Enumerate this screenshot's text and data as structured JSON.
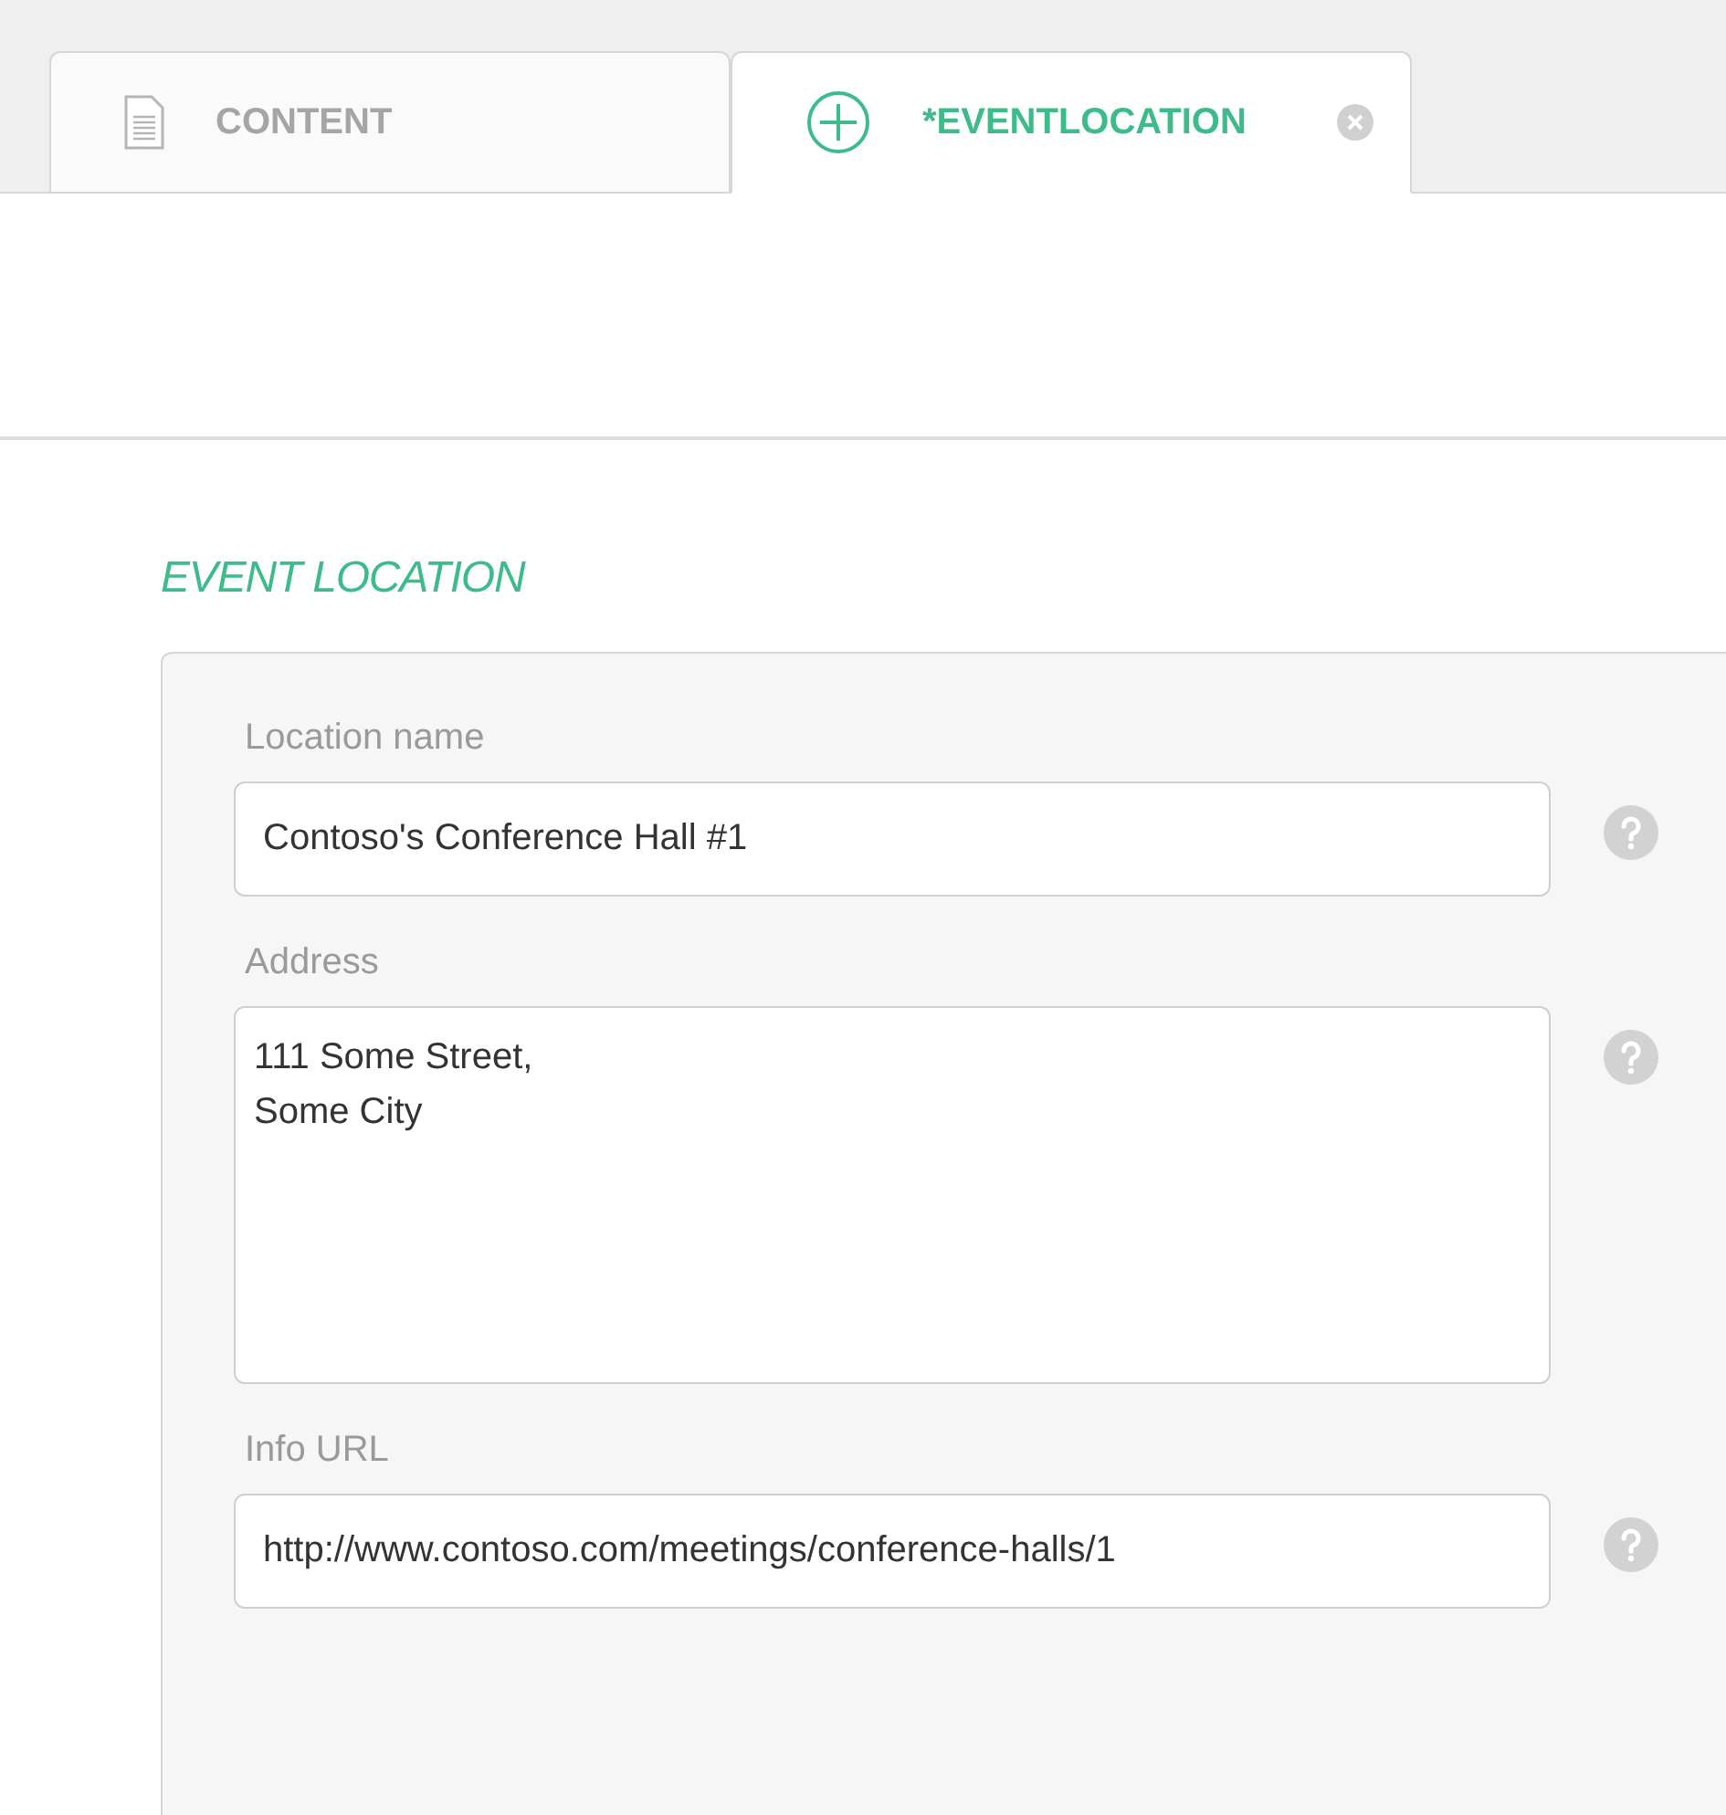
{
  "tabs": [
    {
      "label": "CONTENT",
      "kind": "document",
      "selected": false,
      "closable": false
    },
    {
      "label": "*EVENTLOCATION",
      "kind": "add",
      "selected": true,
      "closable": true
    }
  ],
  "section": {
    "title": "EVENT LOCATION"
  },
  "fields": [
    {
      "label": "Location name",
      "kind": "text",
      "value": "Contoso's Conference Hall #1"
    },
    {
      "label": "Address",
      "kind": "textarea",
      "value": "111 Some Street,\nSome City"
    },
    {
      "label": "Info URL",
      "kind": "text",
      "value": "http://www.contoso.com/meetings/conference-halls/1"
    }
  ]
}
